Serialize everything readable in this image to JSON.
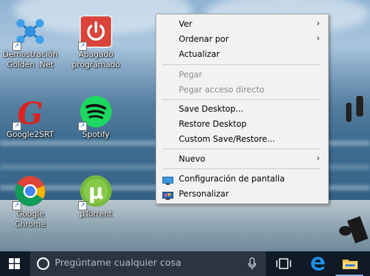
{
  "desktop_icons": [
    {
      "line1": "Demostración",
      "line2": "Golden .Net"
    },
    {
      "line1": "Apagado",
      "line2": "programado"
    },
    {
      "line1": "Google2SRT",
      "line2": ""
    },
    {
      "line1": "Spotify",
      "line2": ""
    },
    {
      "line1": "Google Chrome",
      "line2": ""
    },
    {
      "line1": "µTorrent",
      "line2": ""
    }
  ],
  "context_menu": {
    "items": [
      {
        "label": "Ver",
        "submenu": true,
        "enabled": true
      },
      {
        "label": "Ordenar por",
        "submenu": true,
        "enabled": true
      },
      {
        "label": "Actualizar",
        "submenu": false,
        "enabled": true
      },
      {
        "label": "Pegar",
        "submenu": false,
        "enabled": false
      },
      {
        "label": "Pegar acceso directo",
        "submenu": false,
        "enabled": false
      },
      {
        "label": "Save Desktop...",
        "submenu": false,
        "enabled": true
      },
      {
        "label": "Restore Desktop",
        "submenu": false,
        "enabled": true
      },
      {
        "label": "Custom Save/Restore...",
        "submenu": false,
        "enabled": true
      },
      {
        "label": "Nuevo",
        "submenu": true,
        "enabled": true
      },
      {
        "label": "Configuración de pantalla",
        "submenu": false,
        "enabled": true,
        "icon": "display-settings-icon"
      },
      {
        "label": "Personalizar",
        "submenu": false,
        "enabled": true,
        "icon": "personalize-icon"
      }
    ]
  },
  "taskbar": {
    "search_placeholder": "Pregúntame cualquier cosa",
    "accent": "#0078d7"
  }
}
